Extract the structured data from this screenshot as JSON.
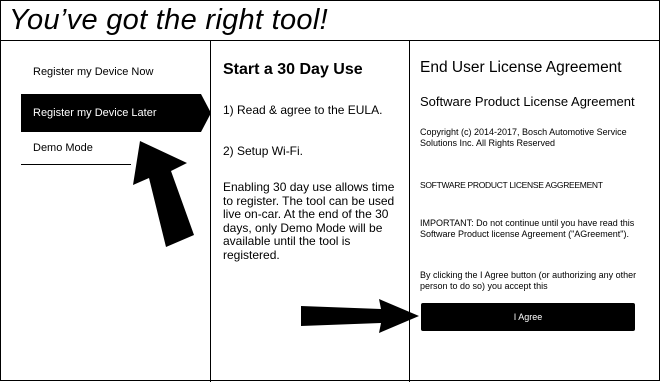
{
  "header": {
    "title": "You’ve got the right tool!"
  },
  "sidebar": {
    "items": [
      {
        "label": "Register my Device Now",
        "active": false
      },
      {
        "label": "Register my Device Later",
        "active": true
      },
      {
        "label": "Demo Mode",
        "active": false
      }
    ]
  },
  "middle": {
    "heading": "Start a 30 Day Use",
    "steps": [
      "1) Read & agree to the EULA.",
      "2) Setup Wi-Fi."
    ],
    "paragraph": "Enabling 30 day use allows time to register. The tool can be used live on-car. At the end of the 30 days, only Demo Mode will be available until the tool is registered."
  },
  "eula": {
    "title": "End User License Agreement",
    "subtitle": "Software Product License Agreement",
    "copyright": "Copyright (c) 2014-2017, Bosch Automotive Service Solutions Inc. All Rights Reserved",
    "heading": "SOFTWARE PRODUCT LICENSE AGGREEMENT",
    "important": "IMPORTANT: Do not continue until you have read this Software Product license Agreement (\"AGreement\").",
    "by_clicking": "By clicking the I Agree button (or authorizing any other person to do so) you accept this",
    "agree_label": "I Agree"
  },
  "colors": {
    "background": "#ffffff",
    "foreground": "#000000",
    "active_item_bg": "#000000",
    "button_bg": "#000000"
  }
}
